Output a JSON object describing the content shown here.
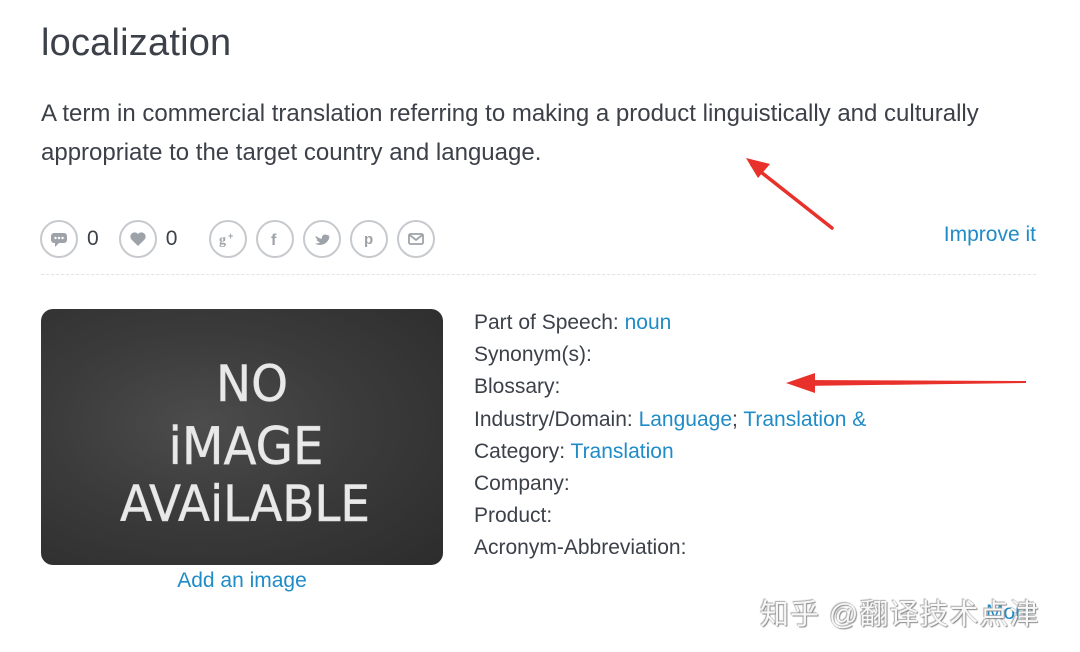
{
  "entry": {
    "term": "localization",
    "definition": "A term in commercial translation referring to making a product linguistically and culturally appropriate to the target country and language."
  },
  "actions": {
    "comments_count": "0",
    "likes_count": "0",
    "icons": [
      "comment-icon",
      "heart-icon",
      "google-plus-icon",
      "facebook-icon",
      "twitter-icon",
      "pinterest-icon",
      "email-icon"
    ],
    "improve_label": "Improve it"
  },
  "image": {
    "placeholder_lines": [
      "NO",
      "iMAGE",
      "AVAiLABLE"
    ],
    "add_label": "Add an image"
  },
  "details": {
    "part_of_speech_label": "Part of Speech:",
    "part_of_speech_value": "noun",
    "synonyms_label": "Synonym(s):",
    "blossary_label": "Blossary:",
    "industry_label": "Industry/Domain:",
    "industry_value_1": "Language",
    "industry_sep": ";",
    "industry_value_2": "Translation &",
    "category_label": "Category:",
    "category_value": "Translation",
    "company_label": "Company:",
    "product_label": "Product:",
    "acronym_label": "Acronym-Abbreviation:"
  },
  "more_label": "More",
  "watermark": "知乎 @翻译技术点津",
  "colors": {
    "link": "#1f8bc7",
    "text": "#3c4149",
    "annotation_arrow": "#e8312a"
  }
}
